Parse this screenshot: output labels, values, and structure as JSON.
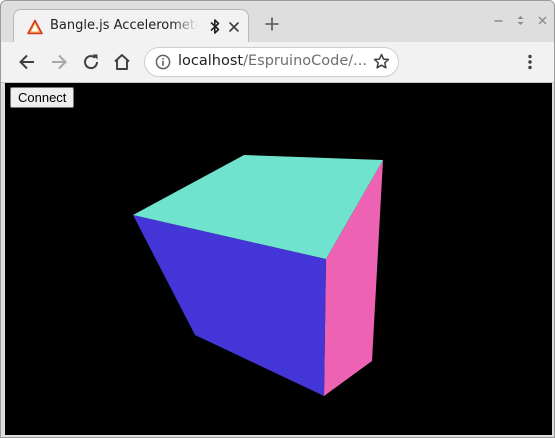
{
  "browser": {
    "tab": {
      "title": "Bangle.js Accelerometer stream",
      "favicon": "warning-triangle-icon",
      "status_icon": "bluetooth-icon"
    },
    "address_bar": {
      "host": "localhost",
      "path": "/EspruinoCode/..."
    }
  },
  "page": {
    "connect_label": "Connect",
    "background_color": "#000000",
    "cube": {
      "top_face_color": "#6fe3cd",
      "front_face_color": "#4335d6",
      "side_face_color": "#ee62b4"
    }
  }
}
